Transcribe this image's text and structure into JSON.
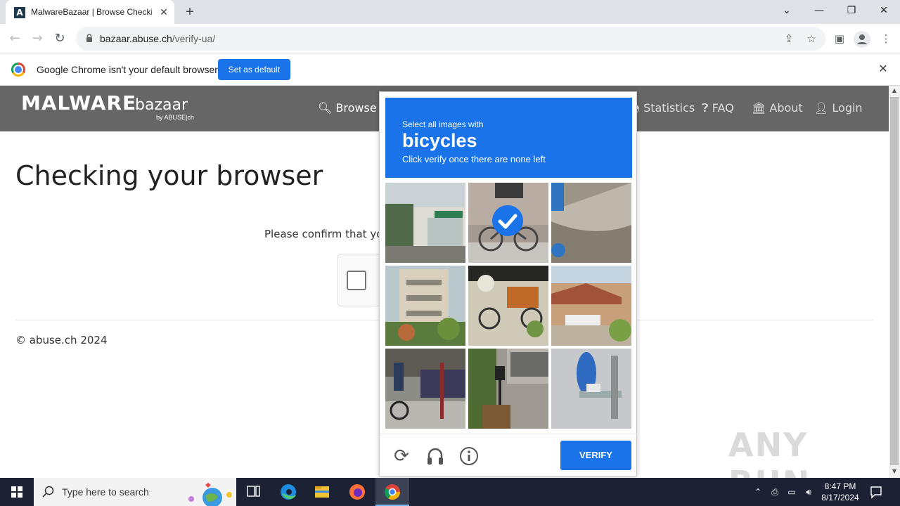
{
  "browser": {
    "tab_title": "MalwareBazaar | Browse Checking your browser",
    "favicon_letter": "A",
    "url_host": "bazaar.abuse.ch",
    "url_path": "/verify-ua/",
    "infobar_text": "Google Chrome isn't your default browser",
    "set_default_label": "Set as default"
  },
  "site": {
    "logo_main": "MALWARE",
    "logo_sub": "bazaar",
    "logo_by": "by ABUSE|ch",
    "nav": {
      "browse": "Browse",
      "statistics": "Statistics",
      "faq": "FAQ",
      "about": "About",
      "login": "Login"
    },
    "page_title": "Checking your browser",
    "confirm_text": "Please confirm that you",
    "copyright": "© abuse.ch 2024"
  },
  "captcha": {
    "instruction_line1": "Select all images with",
    "target": "bicycles",
    "instruction_line3": "Click verify once there are none left",
    "verify_label": "VERIFY",
    "tiles": [
      {
        "subject": "storefront street",
        "selected": false
      },
      {
        "subject": "bicycle against brick wall",
        "selected": true
      },
      {
        "subject": "road curb closeup",
        "selected": false
      },
      {
        "subject": "apartment building",
        "selected": false
      },
      {
        "subject": "cargo bicycle with flowers",
        "selected": false
      },
      {
        "subject": "house with fence",
        "selected": false
      },
      {
        "subject": "cyclist on street",
        "selected": false
      },
      {
        "subject": "parked car and mailbox",
        "selected": false
      },
      {
        "subject": "blue sign on fence",
        "selected": false
      }
    ]
  },
  "taskbar": {
    "search_placeholder": "Type here to search",
    "time": "8:47 PM",
    "date": "8/17/2024"
  },
  "watermark": "ANY RUN",
  "colors": {
    "accent": "#1a73e8",
    "site_header": "#666666"
  }
}
